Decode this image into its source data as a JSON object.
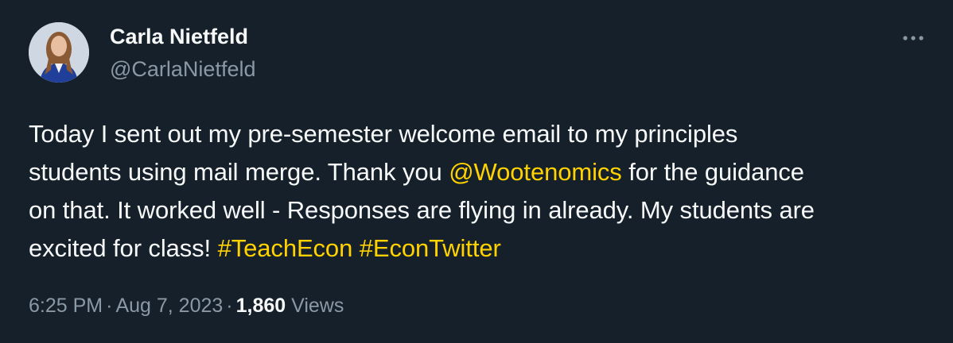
{
  "author": {
    "name": "Carla Nietfeld",
    "handle": "@CarlaNietfeld"
  },
  "tweet": {
    "line1": "Today I sent out my pre-semester welcome email to my principles",
    "line2_a": "students using mail merge. Thank you ",
    "mention": "@Wootenomics",
    "line2_b": " for the guidance",
    "line3": "on that. It worked well - Responses are flying in already. My students are",
    "line4": "excited for class! ",
    "hashtag1": "#TeachEcon",
    "hashtag2": "#EconTwitter"
  },
  "meta": {
    "time": "6:25 PM",
    "separator": "·",
    "date": "Aug 7, 2023",
    "views_count": "1,860",
    "views_label": "Views"
  },
  "icons": {
    "more": "more-horizontal-icon"
  },
  "colors": {
    "background": "#15202b",
    "text": "#f7f9f9",
    "secondary": "#8b98a5",
    "accent": "#ffd200"
  }
}
